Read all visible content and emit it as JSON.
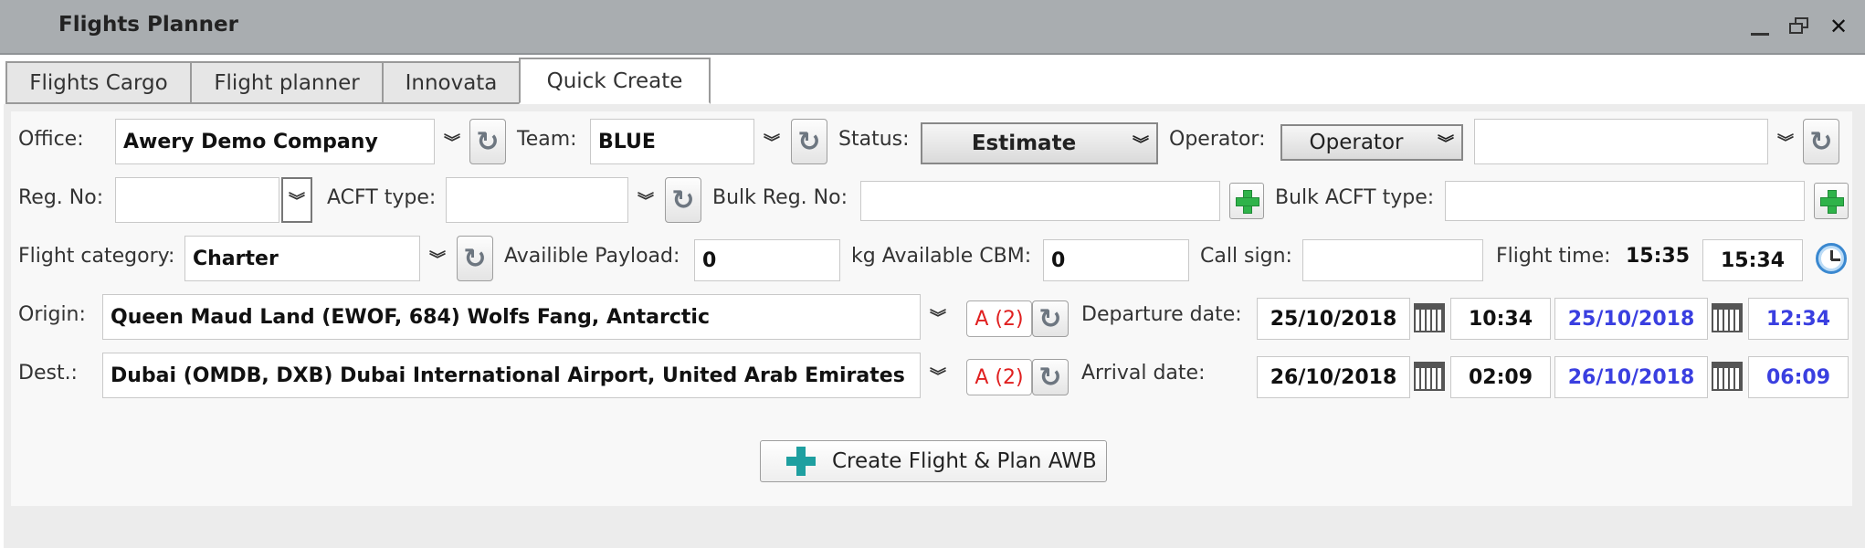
{
  "window": {
    "title": "Flights Planner"
  },
  "tabs": [
    "Flights Cargo",
    "Flight planner",
    "Innovata",
    "Quick Create"
  ],
  "labels": {
    "office": "Office:",
    "team": "Team:",
    "status": "Status:",
    "operator": "Operator:",
    "reg_no": "Reg. No:",
    "acft_type": "ACFT type:",
    "bulk_reg_no": "Bulk Reg. No:",
    "bulk_acft_type": "Bulk ACFT type:",
    "flight_category": "Flight category:",
    "available_payload": "Availible Payload:",
    "kg_available_cbm": "kg Available CBM:",
    "call_sign": "Call sign:",
    "flight_time": "Flight time:",
    "origin": "Origin:",
    "dest": "Dest.:",
    "departure_date": "Departure date:",
    "arrival_date": "Arrival date:"
  },
  "fields": {
    "office": "Awery Demo Company",
    "team": "BLUE",
    "status": "Estimate",
    "operator_select": "Operator",
    "operator_value": "",
    "reg_no": "",
    "acft_type": "",
    "bulk_reg_no": "",
    "bulk_acft_type": "",
    "flight_category": "Charter",
    "available_payload": "0",
    "available_cbm": "0",
    "call_sign": "",
    "flight_time_label_value": "15:35",
    "flight_time_value": "15:34",
    "origin": "Queen Maud Land (EWOF, 684) Wolfs Fang, Antarctic",
    "dest": "Dubai (OMDB, DXB) Dubai International Airport, United Arab Emirates",
    "origin_airport_btn": "A (2)",
    "dest_airport_btn": "A (2)",
    "departure_date": "25/10/2018",
    "departure_time": "10:34",
    "departure_date_local": "25/10/2018",
    "departure_time_local": "12:34",
    "arrival_date": "26/10/2018",
    "arrival_time": "02:09",
    "arrival_date_local": "26/10/2018",
    "arrival_time_local": "06:09"
  },
  "actions": {
    "create": "Create Flight & Plan AWB"
  },
  "colors": {
    "local_time": "#3a3fe0",
    "airport_btn": "#e02020",
    "add_green": "#2fb34a",
    "create_teal": "#1e9fa0"
  }
}
